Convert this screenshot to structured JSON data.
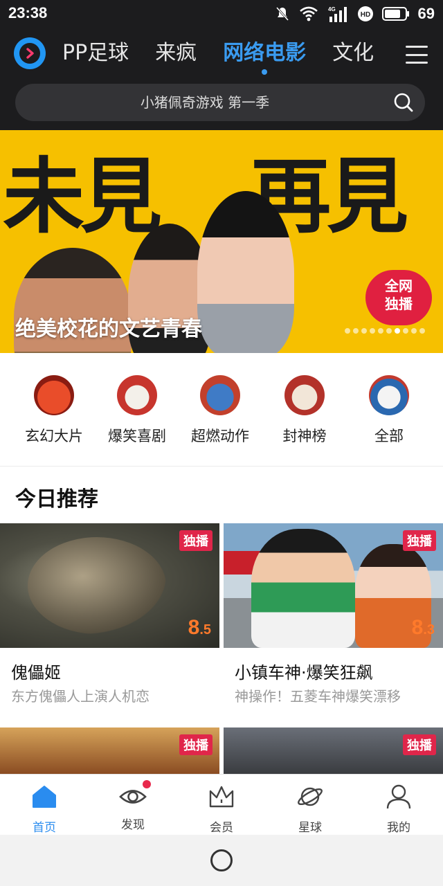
{
  "status_bar": {
    "time": "23:38",
    "battery_percent": "69",
    "network": "4G",
    "icons": [
      "mute-icon",
      "wifi-icon",
      "signal-icon",
      "hd-icon",
      "battery-icon"
    ]
  },
  "header": {
    "logo_icon": "pp-logo-icon",
    "tabs": [
      {
        "label": "PP足球",
        "active": false
      },
      {
        "label": "来疯",
        "active": false
      },
      {
        "label": "网络电影",
        "active": true
      },
      {
        "label": "文化",
        "active": false
      }
    ],
    "menu_icon": "hamburger-menu-icon",
    "search": {
      "placeholder": "小猪佩奇游戏 第一季",
      "icon": "search-icon"
    }
  },
  "banner": {
    "calligraphy_left": "未見",
    "calligraphy_right": "再見",
    "caption": "绝美校花的文艺青春",
    "badge_line1": "全网",
    "badge_line2": "独播",
    "dots_total": 10,
    "dots_active_index": 6
  },
  "categories": [
    {
      "label": "玄幻大片",
      "icon": "dragon-icon"
    },
    {
      "label": "爆笑喜剧",
      "icon": "fan-icon"
    },
    {
      "label": "超燃动作",
      "icon": "fighter-icon"
    },
    {
      "label": "封神榜",
      "icon": "scroll-icon"
    },
    {
      "label": "全部",
      "icon": "book-icon"
    }
  ],
  "section": {
    "title": "今日推荐"
  },
  "cards": [
    {
      "title": "傀儡姬",
      "subtitle": "东方傀儡人上演人机恋",
      "tag": "独播",
      "score_int": "8",
      "score_dec": ".5"
    },
    {
      "title": "小镇车神·爆笑狂飙",
      "subtitle": "神操作！五菱车神爆笑漂移",
      "tag": "独播",
      "score_int": "8",
      "score_dec": ".3"
    },
    {
      "title": "",
      "subtitle": "",
      "tag": "独播",
      "score_int": "",
      "score_dec": ""
    },
    {
      "title": "",
      "subtitle": "",
      "tag": "独播",
      "score_int": "",
      "score_dec": ""
    }
  ],
  "tabbar": [
    {
      "label": "首页",
      "icon": "home-icon",
      "active": true,
      "badge": false
    },
    {
      "label": "发现",
      "icon": "eye-icon",
      "active": false,
      "badge": true
    },
    {
      "label": "会员",
      "icon": "crown-icon",
      "active": false,
      "badge": false
    },
    {
      "label": "星球",
      "icon": "planet-icon",
      "active": false,
      "badge": false
    },
    {
      "label": "我的",
      "icon": "user-icon",
      "active": false,
      "badge": false
    }
  ],
  "colors": {
    "accent": "#3a9bf0",
    "tab_active": "#2a8cef",
    "header_bg": "#1c1c1e",
    "banner_bg": "#f6c000",
    "tag_red": "#e0264a",
    "score_orange": "#ff7a2b"
  }
}
